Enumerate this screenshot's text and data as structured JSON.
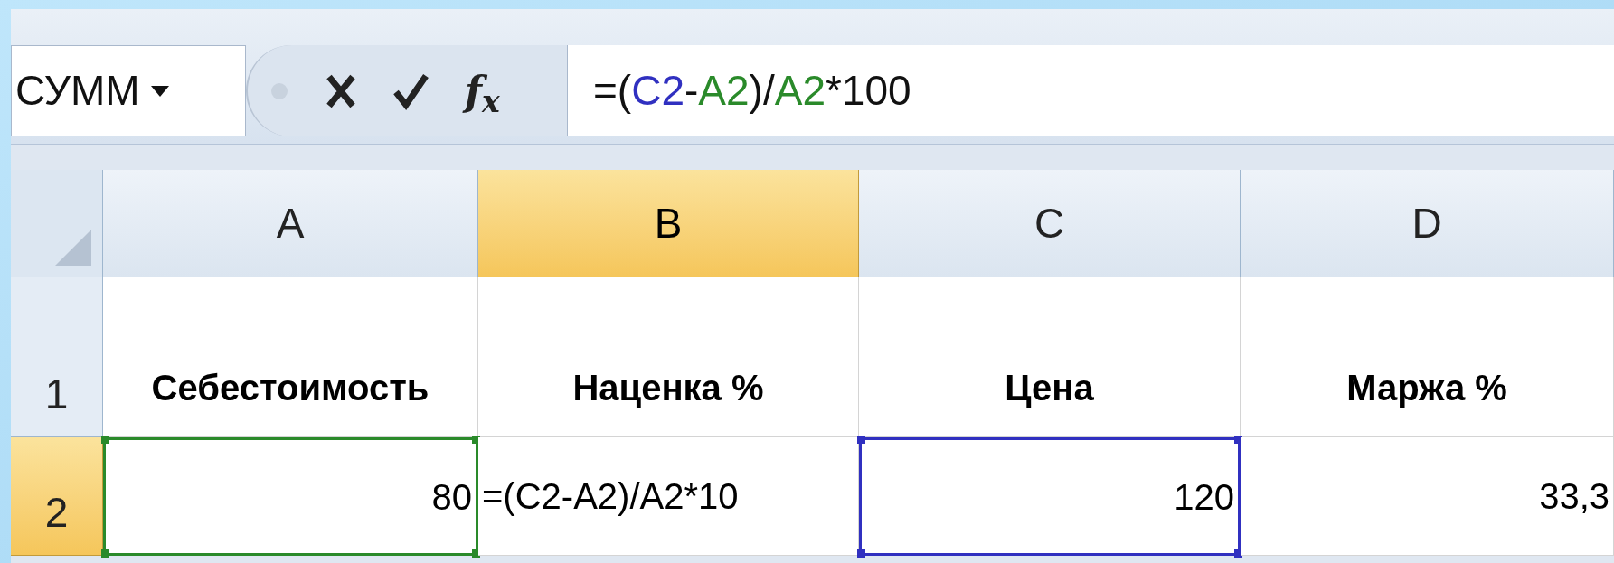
{
  "name_box": {
    "value": "СУММ"
  },
  "function_button": {
    "label": "f$_{x}$"
  },
  "formula": [
    {
      "kind": "plain",
      "text": "=("
    },
    {
      "kind": "ref",
      "text": "C2",
      "color": "#3030c0"
    },
    {
      "kind": "plain",
      "text": "-"
    },
    {
      "kind": "ref",
      "text": "A2",
      "color": "#2a8a2a"
    },
    {
      "kind": "plain",
      "text": ")/"
    },
    {
      "kind": "ref",
      "text": "A2",
      "color": "#2a8a2a"
    },
    {
      "kind": "plain",
      "text": "*100"
    }
  ],
  "columns": [
    {
      "label": "A",
      "selected": false
    },
    {
      "label": "B",
      "selected": true
    },
    {
      "label": "C",
      "selected": false
    },
    {
      "label": "D",
      "selected": false
    }
  ],
  "rows": [
    {
      "header": "1",
      "selected": false,
      "cells": [
        {
          "kind": "heading",
          "text": "Себестоимость"
        },
        {
          "kind": "heading",
          "text": "Наценка %"
        },
        {
          "kind": "heading",
          "text": "Цена"
        },
        {
          "kind": "heading",
          "text": "Маржа %"
        }
      ]
    },
    {
      "header": "2",
      "selected": true,
      "cells": [
        {
          "kind": "number",
          "text": "80",
          "color": "#2a8a2a"
        },
        {
          "kind": "formula",
          "text": "=(C2-A2)/A2*10"
        },
        {
          "kind": "number",
          "text": "120",
          "color": "#3030c0"
        },
        {
          "kind": "number",
          "text": "33,3"
        }
      ]
    }
  ]
}
